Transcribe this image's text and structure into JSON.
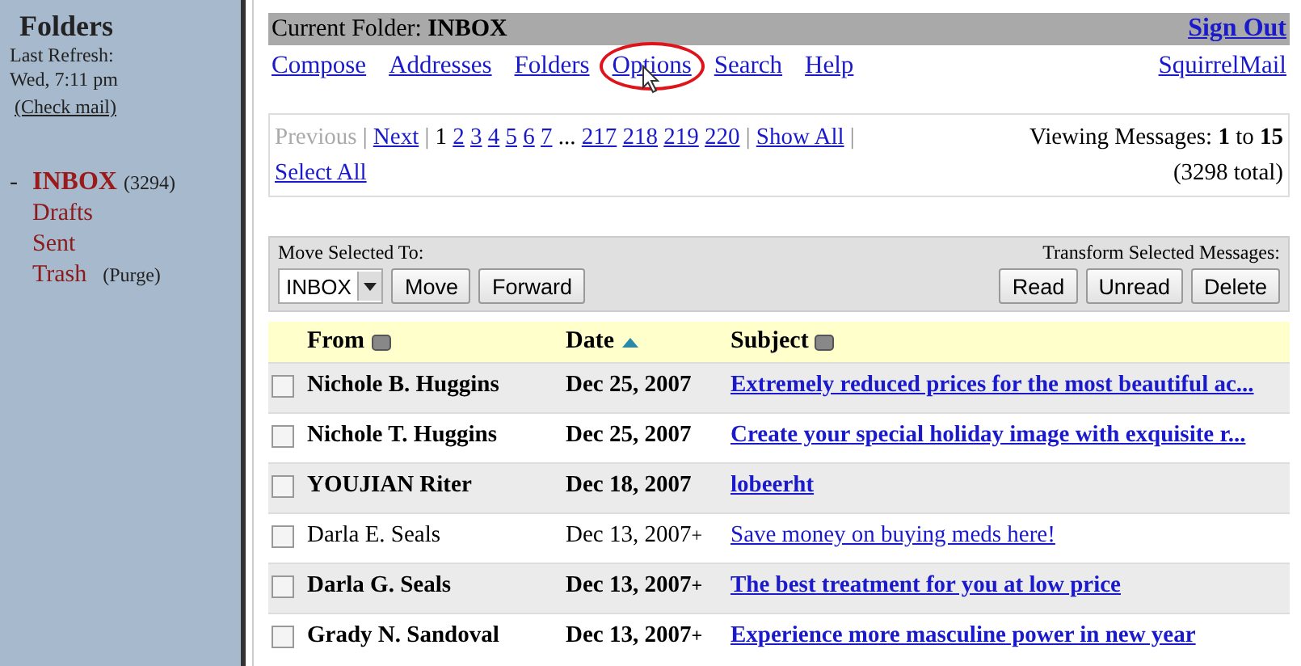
{
  "sidebar": {
    "title": "Folders",
    "refresh_label": "Last Refresh:",
    "refresh_time": "Wed, 7:11 pm",
    "check_mail": "(Check mail)",
    "folders": [
      {
        "marker": "-",
        "name": "INBOX",
        "count": "(3294)",
        "selected": true
      },
      {
        "name": "Drafts",
        "selected": false
      },
      {
        "name": "Sent",
        "selected": false
      },
      {
        "name": "Trash",
        "extra": "(Purge)",
        "selected": false
      }
    ]
  },
  "header": {
    "label": "Current Folder:",
    "folder": "INBOX",
    "sign_out": "Sign Out"
  },
  "nav": [
    {
      "label": "Compose",
      "circled": false
    },
    {
      "label": "Addresses",
      "circled": false
    },
    {
      "label": "Folders",
      "circled": false
    },
    {
      "label": "Options",
      "circled": true
    },
    {
      "label": "Search",
      "circled": false
    },
    {
      "label": "Help",
      "circled": false
    }
  ],
  "brand_link": "SquirrelMail",
  "pagination": [
    {
      "label": "Previous",
      "kind": "disabled"
    },
    {
      "label": "|",
      "kind": "separator"
    },
    {
      "label": "Next",
      "kind": "link"
    },
    {
      "label": "|",
      "kind": "separator"
    },
    {
      "label": "1",
      "kind": "current"
    },
    {
      "label": "2",
      "kind": "link"
    },
    {
      "label": "3",
      "kind": "link"
    },
    {
      "label": "4",
      "kind": "link"
    },
    {
      "label": "5",
      "kind": "link"
    },
    {
      "label": "6",
      "kind": "link"
    },
    {
      "label": "7",
      "kind": "link"
    },
    {
      "label": "...",
      "kind": "current"
    },
    {
      "label": "217",
      "kind": "link"
    },
    {
      "label": "218",
      "kind": "link"
    },
    {
      "label": "219",
      "kind": "link"
    },
    {
      "label": "220",
      "kind": "link"
    },
    {
      "label": "|",
      "kind": "separator"
    },
    {
      "label": "Show All",
      "kind": "link"
    },
    {
      "label": "|",
      "kind": "separator"
    },
    {
      "label": "Select All",
      "kind": "link"
    }
  ],
  "viewing": "Viewing Messages: **1** to **15**",
  "total": "(3298 total)",
  "move": {
    "label": "Move Selected To:",
    "folder": "INBOX",
    "buttons": [
      "Move",
      "Forward"
    ]
  },
  "transform": {
    "label": "Transform Selected Messages:",
    "buttons": [
      "Read",
      "Unread",
      "Delete"
    ]
  },
  "columns": [
    {
      "label": "From",
      "kind": "unsorted"
    },
    {
      "label": "Date",
      "kind": "ascending"
    },
    {
      "label": "Subject",
      "kind": "unsorted"
    }
  ],
  "messages": [
    {
      "from": "Nichole B. Huggins",
      "date": "Dec 25, 2007",
      "subject": "Extremely reduced prices for the most beautiful ac...",
      "unread": true,
      "checked": false
    },
    {
      "from": "Nichole T. Huggins",
      "date": "Dec 25, 2007",
      "subject": "Create your special holiday image with exquisite r...",
      "unread": true,
      "checked": false
    },
    {
      "from": "YOUJIAN Riter",
      "date": "Dec 18, 2007",
      "subject": "lobeerht",
      "unread": true,
      "checked": false
    },
    {
      "from": "Darla E. Seals",
      "date": "Dec 13, 2007",
      "flag": "+",
      "subject": "Save money on buying meds here!",
      "unread": false,
      "checked": false
    },
    {
      "from": "Darla G. Seals",
      "date": "Dec 13, 2007",
      "flag": "+",
      "subject": "The best treatment for you at low price",
      "unread": true,
      "checked": false
    },
    {
      "from": "Grady N. Sandoval",
      "date": "Dec 13, 2007",
      "flag": "+",
      "subject": "Experience more masculine power in new year",
      "unread": true,
      "checked": false
    }
  ]
}
